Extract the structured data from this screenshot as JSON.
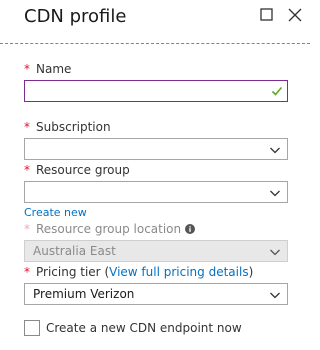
{
  "blade": {
    "title": "CDN profile"
  },
  "form": {
    "required_marker": "*",
    "name": {
      "label": "Name",
      "value": "",
      "valid": true
    },
    "subscription": {
      "label": "Subscription",
      "value": ""
    },
    "resource_group": {
      "label": "Resource group",
      "value": "",
      "create_new_link": "Create new"
    },
    "resource_group_location": {
      "label": "Resource group location",
      "value": "Australia East",
      "disabled": true
    },
    "pricing_tier": {
      "label": "Pricing tier",
      "open_paren": "(",
      "link": "View full pricing details",
      "close_paren": ")",
      "value": "Premium Verizon"
    },
    "create_endpoint": {
      "label": "Create a new CDN endpoint now",
      "checked": false
    }
  },
  "colors": {
    "required": "#e81123",
    "link": "#0072c6",
    "focus_border": "#7d2b8f",
    "valid_check": "#5ba829",
    "header_rule": "#2aa3c8"
  },
  "icons": {
    "maximize": "maximize-icon",
    "close": "close-icon",
    "dropdown": "chevron-down-icon",
    "valid": "checkmark-icon",
    "info": "info-icon"
  }
}
